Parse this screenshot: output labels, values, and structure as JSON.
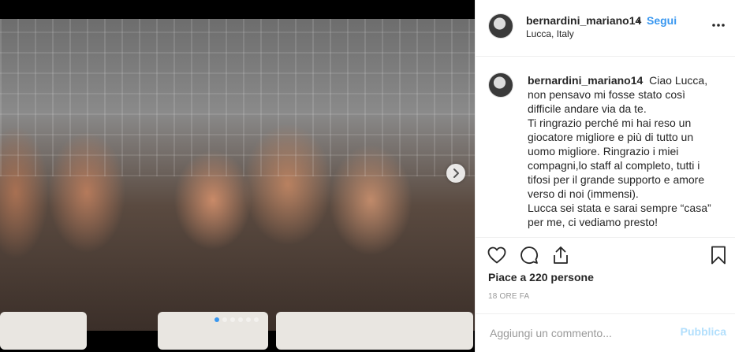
{
  "post": {
    "username": "bernardini_mariano14",
    "follow_bullet": "•",
    "follow_label": "Segui",
    "location": "Lucca, Italy",
    "caption_lines": [
      "Ciao Lucca,",
      "non pensavo mi fosse stato così",
      "difficile andare via da te.",
      "Ti ringrazio perché mi hai reso un",
      "giocatore migliore e più di tutto un",
      "uomo migliore. Ringrazio i miei",
      "compagni,lo staff al completo, tutti i",
      "tifosi per il grande supporto e amore",
      "verso di noi (immensi).",
      "Lucca sei stata e sarai sempre “casa”",
      "per me, ci vediamo presto!"
    ],
    "likes_text": "Piace a 220 persone",
    "time_ago": "18 ORE FA"
  },
  "carousel": {
    "total_slides": 6,
    "active_slide": 1
  },
  "comment": {
    "placeholder": "Aggiungi un commento...",
    "publish_label": "Pubblica"
  },
  "icons": {
    "more": "more-options-icon",
    "like": "heart-icon",
    "comment": "comment-bubble-icon",
    "share": "share-icon",
    "save": "bookmark-icon",
    "next": "chevron-right-icon"
  },
  "colors": {
    "accent": "#3897f0",
    "publish_disabled": "#b2dffc",
    "text": "#262626",
    "muted": "#999999"
  }
}
